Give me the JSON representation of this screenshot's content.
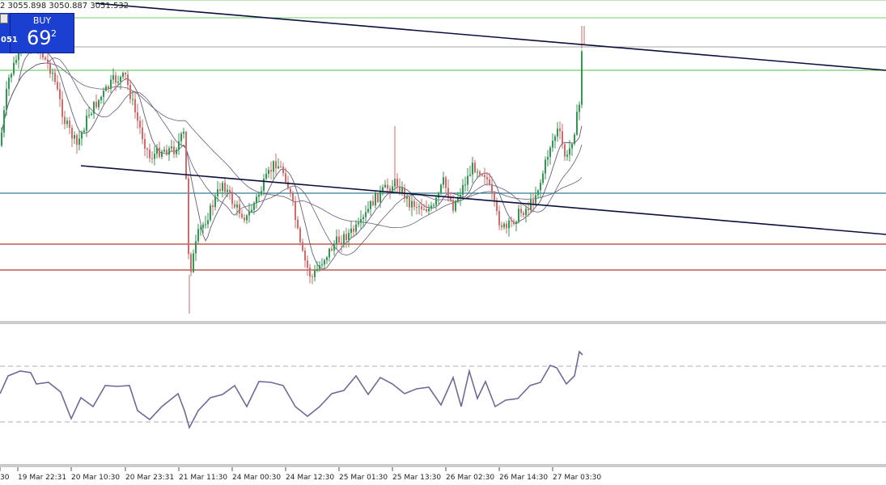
{
  "ohlc_readout": "2 3055.898 3050.887 3051.532",
  "trade_panel": {
    "buy_label": "BUY",
    "price_prefix": "051",
    "price_big": "69",
    "price_sup": "2"
  },
  "colors": {
    "bull_candle": "#2f9a4f",
    "bear_candle": "#d26a6a",
    "trendline": "#0b0f3a",
    "green_level": "#6fcf6f",
    "teal_level": "#2f7f8f",
    "red_level": "#b03a2e",
    "ma": "#6a5a7a",
    "oscillator": "#6d6a98",
    "button_bg": "#1a3fd1"
  },
  "x_axis": {
    "labels": [
      "30",
      "19 Mar 22:31",
      "20 Mar 10:30",
      "20 Mar 23:31",
      "21 Mar 11:30",
      "24 Mar 00:30",
      "24 Mar 12:30",
      "25 Mar 01:30",
      "25 Mar 13:30",
      "26 Mar 02:30",
      "26 Mar 14:30",
      "27 Mar 03:30"
    ]
  }
}
